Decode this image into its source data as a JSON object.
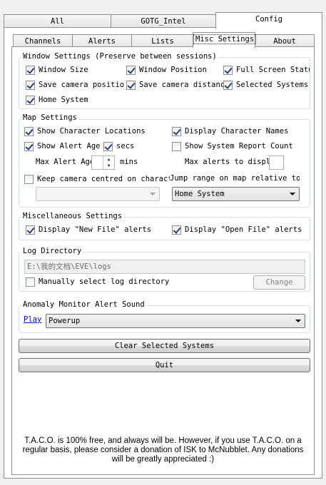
{
  "top_tabs": [
    {
      "label": "All"
    },
    {
      "label": "GOTG_Intel"
    },
    {
      "label": "Config"
    }
  ],
  "sub_tabs": [
    {
      "label": "Channels"
    },
    {
      "label": "Alerts"
    },
    {
      "label": "Lists"
    },
    {
      "label": "Misc Settings"
    },
    {
      "label": "About"
    }
  ],
  "window_settings": {
    "title": "Window Settings (Preserve between sessions)",
    "window_size": {
      "label": "Window Size",
      "checked": true
    },
    "window_position": {
      "label": "Window Position",
      "checked": true
    },
    "full_screen_status": {
      "label": "Full Screen Status",
      "checked": true
    },
    "save_camera_position": {
      "label": "Save camera position",
      "checked": true
    },
    "save_camera_distance": {
      "label": "Save camera distance",
      "checked": true
    },
    "selected_systems": {
      "label": "Selected Systems",
      "checked": true
    },
    "home_system": {
      "label": "Home System",
      "checked": true
    }
  },
  "map_settings": {
    "title": "Map Settings",
    "show_character_locations": {
      "label": "Show Character Locations",
      "checked": true
    },
    "display_character_names": {
      "label": "Display Character Names",
      "checked": true
    },
    "show_alert_age": {
      "label": "Show Alert Age",
      "checked": true
    },
    "secs": {
      "label": "secs",
      "checked": true
    },
    "show_system_report_count": {
      "label": "Show System Report Count",
      "checked": false
    },
    "max_alert_age_label": "Max Alert Age",
    "max_alert_age_value": "",
    "mins_label": "mins",
    "max_alerts_label": "Max alerts to display",
    "max_alerts_value": "",
    "keep_camera_centred": {
      "label": "Keep camera centred on character",
      "checked": false
    },
    "jump_range_label": "Jump range on map relative to:",
    "character_select_value": "",
    "jump_range_value": "Home System"
  },
  "misc_settings": {
    "title": "Miscellaneous Settings",
    "display_new_file_alerts": {
      "label": "Display \"New File\" alerts",
      "checked": true
    },
    "display_open_file_alerts": {
      "label": "Display \"Open File\" alerts",
      "checked": true
    }
  },
  "log_directory": {
    "title": "Log Directory",
    "path": "E:\\我的文档\\EVE\\logs",
    "manual_select": {
      "label": "Manually select log directory",
      "checked": false
    },
    "change_label": "Change"
  },
  "anomaly_sound": {
    "title": "Anomaly Monitor Alert Sound",
    "play_label": "Play",
    "sound_value": "Powerup"
  },
  "buttons": {
    "clear_selected_systems": "Clear Selected Systems",
    "quit": "Quit"
  },
  "footer_text": "T.A.C.O. is 100% free, and always will be.  However, if you use T.A.C.O. on a regular basis, please consider a donation of ISK to McNubblet. Any donations will be greatly appreciated :)"
}
